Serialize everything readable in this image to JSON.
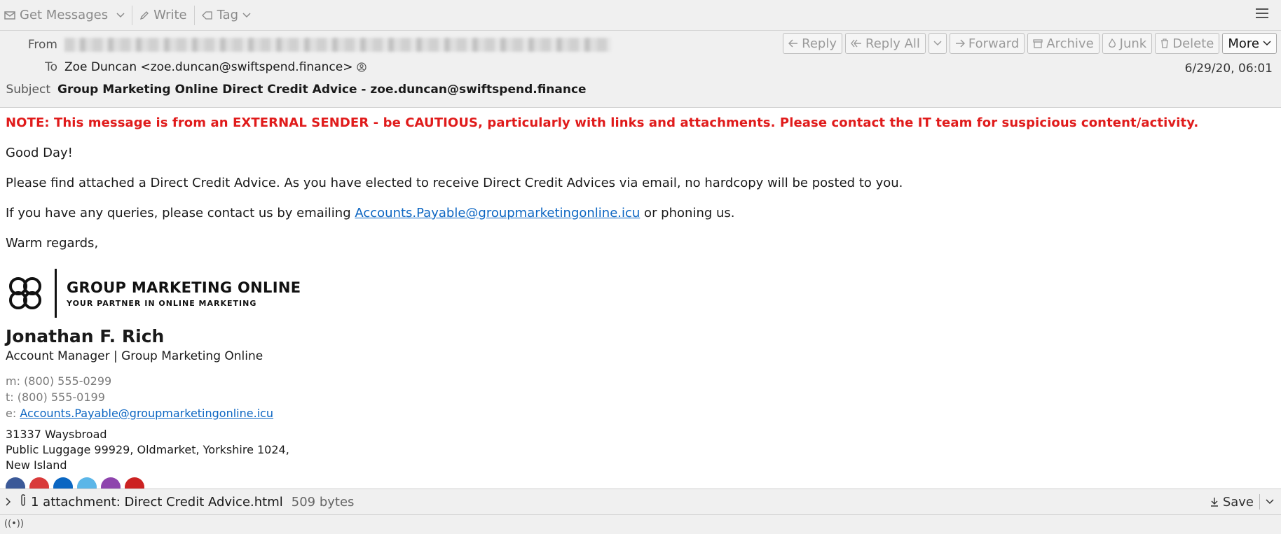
{
  "toolbar": {
    "get_messages": "Get Messages",
    "write": "Write",
    "tag": "Tag"
  },
  "header": {
    "from_label": "From",
    "to_label": "To",
    "to_value": "Zoe Duncan <zoe.duncan@swiftspend.finance>",
    "subject_label": "Subject",
    "subject_value": "Group Marketing Online Direct Credit Advice - zoe.duncan@swiftspend.finance",
    "date": "6/29/20, 06:01",
    "buttons": {
      "reply": "Reply",
      "reply_all": "Reply All",
      "forward": "Forward",
      "archive": "Archive",
      "junk": "Junk",
      "delete": "Delete",
      "more": "More"
    }
  },
  "body": {
    "note": "NOTE: This message is from an EXTERNAL SENDER - be CAUTIOUS, particularly with links and attachments. Please contact the IT team for suspicious content/activity.",
    "greeting": "Good Day!",
    "para1": "Please find attached a Direct Credit Advice. As you have elected to receive Direct Credit Advices via email, no hardcopy will be posted to you.",
    "para2_prefix": "If you have any queries, please contact us by emailing ",
    "para2_link": "Accounts.Payable@groupmarketingonline.icu",
    "para2_suffix": " or phoning us.",
    "closing": "Warm regards,"
  },
  "signature": {
    "logo_title": "GROUP MARKETING ONLINE",
    "logo_subtitle": "YOUR PARTNER IN ONLINE MARKETING",
    "name": "Jonathan F. Rich",
    "title": "Account Manager | Group Marketing Online",
    "mobile": "m: (800) 555-0299",
    "phone": "t: (800) 555-0199",
    "email_prefix": "e: ",
    "email": "Accounts.Payable@groupmarketingonline.icu",
    "address_line1": "31337 Waysbroad",
    "address_line2": "Public Luggage 99929, Oldmarket, Yorkshire 1024,",
    "address_line3": "New Island",
    "social_colors": [
      "#3b5998",
      "#d93a3a",
      "#0a66c2",
      "#5bb6e8",
      "#8e44ad",
      "#cc2222"
    ]
  },
  "attachment": {
    "label": "1 attachment: Direct Credit Advice.html",
    "size": "509 bytes",
    "save": "Save"
  },
  "colors": {
    "warning": "#e01b1b",
    "link": "#0b65c2",
    "chrome": "#f0f0f0"
  }
}
